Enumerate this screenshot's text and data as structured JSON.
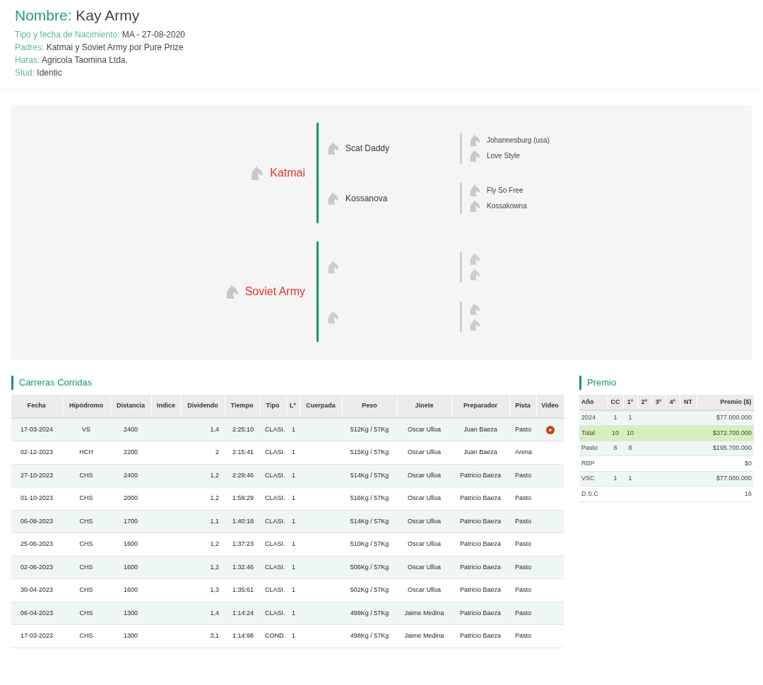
{
  "header": {
    "name_label": "Nombre:",
    "name": "Kay Army",
    "fields": [
      {
        "label": "Tipo y fecha de Nacimiento:",
        "value": "MA - 27-08-2020"
      },
      {
        "label": "Padres:",
        "value": "Katmai y Soviet Army por Pure Prize"
      },
      {
        "label": "Haras:",
        "value": "Agricola Taomina Ltda."
      },
      {
        "label": "Stud:",
        "value": "Identic"
      }
    ]
  },
  "pedigree": [
    {
      "name": "Katmai",
      "parents": [
        {
          "name": "Scat Daddy",
          "parents": [
            {
              "name": "Johannesburg (usa)"
            },
            {
              "name": "Love Style"
            }
          ]
        },
        {
          "name": "Kossanova",
          "parents": [
            {
              "name": "Fly So Free"
            },
            {
              "name": "Kossakowna"
            }
          ]
        }
      ]
    },
    {
      "name": "Soviet Army",
      "parents": [
        {
          "kind": "unknown",
          "parents": [
            {
              "kind": "unknown"
            },
            {
              "kind": "unknown"
            }
          ]
        },
        {
          "kind": "unknown",
          "parents": [
            {
              "kind": "unknown"
            },
            {
              "kind": "unknown"
            }
          ]
        }
      ]
    }
  ],
  "races": {
    "title": "Carreras Corridas",
    "columns": [
      "Fecha",
      "Hipódromo",
      "Distancia",
      "Indice",
      "Dividendo",
      "Tiempo",
      "Tipo",
      "Lº",
      "Cuerpada",
      "Peso",
      "Jinete",
      "Preparador",
      "Pista",
      "Video"
    ],
    "rows": [
      {
        "cells": [
          "17-03-2024",
          "VS",
          "2400",
          "",
          "1,4",
          "2:25:10",
          "CLASI.",
          "1",
          "",
          "512Kg / 57Kg",
          "Oscar Ulloa",
          "Juan Baeza",
          "Pasto"
        ],
        "video": true
      },
      {
        "cells": [
          "02-12-2023",
          "HCH",
          "2200",
          "",
          "2",
          "2:15:41",
          "CLASI.",
          "1",
          "",
          "515Kg / 57Kg",
          "Oscar Ulloa",
          "Juan Baeza",
          "Arena"
        ],
        "video": false
      },
      {
        "cells": [
          "27-10-2023",
          "CHS",
          "2400",
          "",
          "1,2",
          "2:29:46",
          "CLASI.",
          "1",
          "",
          "514Kg / 57Kg",
          "Oscar Ulloa",
          "Patricio Baeza",
          "Pasto"
        ],
        "video": false
      },
      {
        "cells": [
          "01-10-2023",
          "CHS",
          "2000",
          "",
          "1,2",
          "1:59:29",
          "CLASI.",
          "1",
          "",
          "516Kg / 57Kg",
          "Oscar Ulloa",
          "Patricio Baeza",
          "Pasto"
        ],
        "video": false
      },
      {
        "cells": [
          "06-08-2023",
          "CHS",
          "1700",
          "",
          "1,1",
          "1:40:18",
          "CLASI.",
          "1",
          "",
          "514Kg / 57Kg",
          "Oscar Ulloa",
          "Patricio Baeza",
          "Pasto"
        ],
        "video": false
      },
      {
        "cells": [
          "25-06-2023",
          "CHS",
          "1600",
          "",
          "1,2",
          "1:37:23",
          "CLASI.",
          "1",
          "",
          "510Kg / 57Kg",
          "Oscar Ulloa",
          "Patricio Baeza",
          "Pasto"
        ],
        "video": false
      },
      {
        "cells": [
          "02-06-2023",
          "CHS",
          "1600",
          "",
          "1,2",
          "1:32:46",
          "CLASI.",
          "1",
          "",
          "506Kg / 57Kg",
          "Oscar Ulloa",
          "Patricio Baeza",
          "Pasto"
        ],
        "video": false
      },
      {
        "cells": [
          "30-04-2023",
          "CHS",
          "1600",
          "",
          "1,3",
          "1:35:61",
          "CLASI.",
          "1",
          "",
          "502Kg / 57Kg",
          "Oscar Ulloa",
          "Patricio Baeza",
          "Pasto"
        ],
        "video": false
      },
      {
        "cells": [
          "06-04-2023",
          "CHS",
          "1300",
          "",
          "1,4",
          "1:14:24",
          "CLASI.",
          "1",
          "",
          "499Kg / 57Kg",
          "Jaime Medina",
          "Patricio Baeza",
          "Pasto"
        ],
        "video": false
      },
      {
        "cells": [
          "17-03-2023",
          "CHS",
          "1300",
          "",
          "3,1",
          "1:14:98",
          "COND.",
          "1",
          "",
          "498Kg / 57Kg",
          "Jaime Medina",
          "Patricio Baeza",
          "Pasto"
        ],
        "video": false
      }
    ]
  },
  "prizes": {
    "title": "Premio",
    "columns": [
      "Año",
      "CC",
      "1º",
      "2º",
      "3º",
      "4º",
      "NT",
      "Premio ($)"
    ],
    "rows": [
      {
        "cells": [
          "2024",
          "1",
          "1",
          "",
          "",
          "",
          "",
          "$77.000.000"
        ],
        "highlighted": false
      },
      {
        "cells": [
          "Total",
          "10",
          "10",
          "",
          "",
          "",
          "",
          "$372.700.000"
        ],
        "highlighted": true
      },
      {
        "cells": [
          "Pasto",
          "8",
          "8",
          "",
          "",
          "",
          "",
          "$195.700.000"
        ],
        "highlighted": false
      },
      {
        "cells": [
          "RBP",
          "",
          "",
          "",
          "",
          "",
          "",
          "$0"
        ],
        "highlighted": false
      },
      {
        "cells": [
          "VSC",
          "1",
          "1",
          "",
          "",
          "",
          "",
          "$77.000.000"
        ],
        "highlighted": false
      },
      {
        "cells": [
          "D.S.C",
          "",
          "",
          "",
          "",
          "",
          "",
          "16"
        ],
        "highlighted": false
      }
    ]
  }
}
